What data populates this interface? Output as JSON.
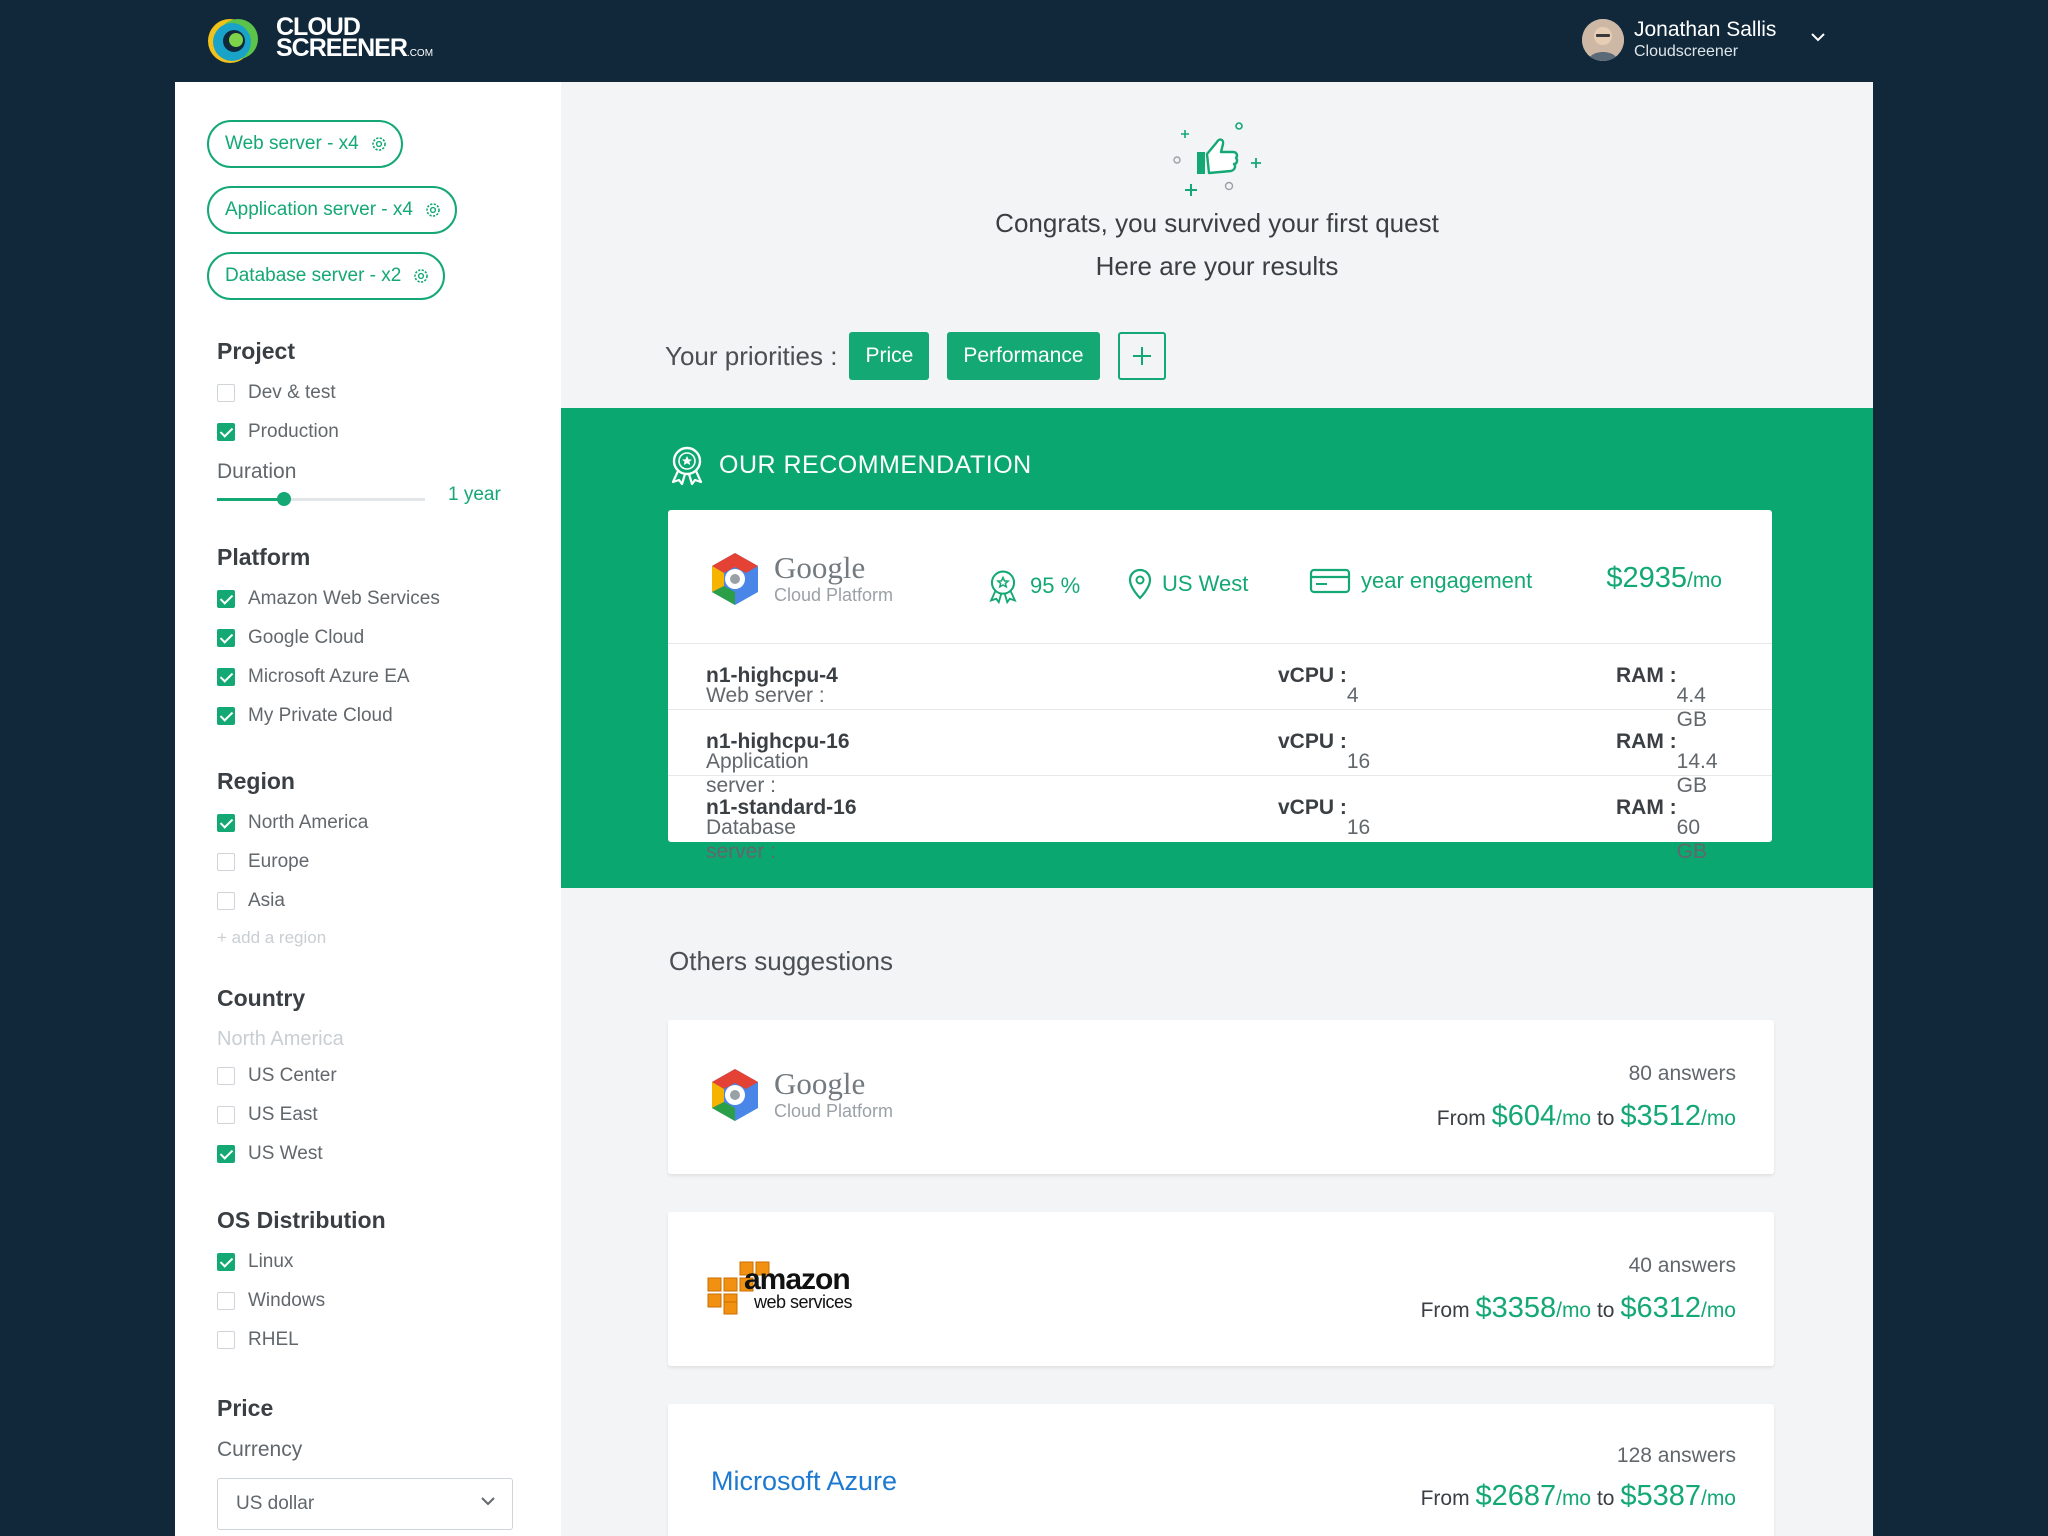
{
  "header": {
    "logo_line1": "CLOUD",
    "logo_line2": "SCREENER",
    "logo_suffix": ".COM",
    "user_name": "Jonathan Sallis",
    "user_org": "Cloudscreener"
  },
  "sidebar": {
    "chips": [
      {
        "label": "Web server - x4"
      },
      {
        "label": "Application server - x4"
      },
      {
        "label": "Database server - x2"
      }
    ],
    "project": {
      "title": "Project",
      "options": [
        {
          "label": "Dev & test",
          "checked": false
        },
        {
          "label": "Production",
          "checked": true
        }
      ],
      "duration_label": "Duration",
      "duration_value": "1 year",
      "duration_fraction": 0.32
    },
    "platform": {
      "title": "Platform",
      "options": [
        {
          "label": "Amazon Web Services",
          "checked": true
        },
        {
          "label": "Google Cloud",
          "checked": true
        },
        {
          "label": "Microsoft Azure EA",
          "checked": true
        },
        {
          "label": "My Private Cloud",
          "checked": true
        }
      ]
    },
    "region": {
      "title": "Region",
      "options": [
        {
          "label": "North America",
          "checked": true
        },
        {
          "label": "Europe",
          "checked": false
        },
        {
          "label": "Asia",
          "checked": false
        }
      ],
      "add_label": "add a region"
    },
    "country": {
      "title": "Country",
      "group_label": "North America",
      "options": [
        {
          "label": "US Center",
          "checked": false
        },
        {
          "label": "US East",
          "checked": false
        },
        {
          "label": "US West",
          "checked": true
        }
      ]
    },
    "os": {
      "title": "OS Distribution",
      "options": [
        {
          "label": "Linux",
          "checked": true
        },
        {
          "label": "Windows",
          "checked": false
        },
        {
          "label": "RHEL",
          "checked": false
        }
      ]
    },
    "price": {
      "title": "Price",
      "currency_label": "Currency",
      "currency_value": "US dollar"
    }
  },
  "hero": {
    "line1": "Congrats, you survived your first quest",
    "line2": "Here are your results",
    "priorities_label": "Your priorities :",
    "priorities": [
      "Price",
      "Performance"
    ]
  },
  "recommendation": {
    "title": "OUR RECOMMENDATION",
    "provider_word1": "Google",
    "provider_word2": "Cloud Platform",
    "score": "95 %",
    "region": "US West",
    "engagement": "year engagement",
    "price": "$2935",
    "price_unit": "/mo",
    "specs": [
      {
        "role": "Web server :",
        "instance": "n1-highcpu-4",
        "vcpu_label": "vCPU :",
        "vcpu": "4",
        "ram_label": "RAM :",
        "ram": "4.4 GB"
      },
      {
        "role": "Application server :",
        "instance": "n1-highcpu-16",
        "vcpu_label": "vCPU :",
        "vcpu": "16",
        "ram_label": "RAM :",
        "ram": "14.4 GB"
      },
      {
        "role": "Database server :",
        "instance": "n1-standard-16",
        "vcpu_label": "vCPU :",
        "vcpu": "16",
        "ram_label": "RAM :",
        "ram": "60 GB"
      }
    ]
  },
  "others": {
    "title": "Others suggestions",
    "items": [
      {
        "provider_word1": "Google",
        "provider_word2": "Cloud Platform",
        "answers": "80 answers",
        "from_label": "From",
        "from": "$604",
        "to_label": "to",
        "to": "$3512",
        "unit": "/mo"
      },
      {
        "provider_word1": "amazon",
        "provider_word2": "web services",
        "answers": "40 answers",
        "from_label": "From",
        "from": "$3358",
        "to_label": "to",
        "to": "$6312",
        "unit": "/mo"
      },
      {
        "provider_word1": "Microsoft Azure",
        "answers": "128 answers",
        "from_label": "From",
        "from": "$2687",
        "to_label": "to",
        "to": "$5387",
        "unit": "/mo"
      }
    ]
  },
  "colors": {
    "accent": "#14a874",
    "header_bg": "#10283a",
    "recommendation_bg": "#0aa870",
    "azure_blue": "#1e7ad1"
  },
  "icons": [
    "logo-mark",
    "gear-icon",
    "chevron-down-icon",
    "thumbs-up-icon",
    "award-icon",
    "location-pin-icon",
    "card-icon",
    "google-hexagon-icon",
    "aws-boxes-icon"
  ]
}
